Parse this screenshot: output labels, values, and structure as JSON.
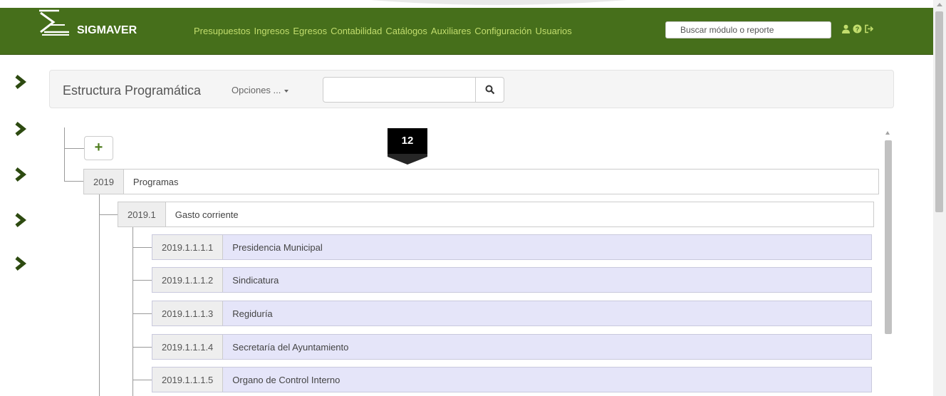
{
  "app": {
    "brand": "SIGMAVER",
    "accent_color": "#466f1b",
    "link_color": "#c2dd6d"
  },
  "nav": {
    "items": [
      "Presupuestos",
      "Ingresos",
      "Egresos",
      "Contabilidad",
      "Catálogos",
      "Auxiliares",
      "Configuración",
      "Usuarios"
    ],
    "search_placeholder": "Buscar módulo o reporte",
    "icons": [
      "user-icon",
      "help-icon",
      "logout-icon"
    ]
  },
  "sidebar": {
    "icons": [
      "chevron-right-icon",
      "chevron-right-icon",
      "chevron-right-icon",
      "chevron-right-icon",
      "chevron-right-icon"
    ]
  },
  "toolbar": {
    "title": "Estructura Programática",
    "options_label": "Opciones ...",
    "search_value": "",
    "search_icon": "search-icon"
  },
  "tree": {
    "add_label": "+",
    "step_badge": "12",
    "root": {
      "code": "2019",
      "name": "Programas"
    },
    "level1": {
      "code": "2019.1",
      "name": "Gasto corriente"
    },
    "leaves": [
      {
        "code": "2019.1.1.1.1",
        "name": "Presidencia Municipal"
      },
      {
        "code": "2019.1.1.1.2",
        "name": "Sindicatura"
      },
      {
        "code": "2019.1.1.1.3",
        "name": "Regiduría"
      },
      {
        "code": "2019.1.1.1.4",
        "name": "Secretaría del Ayuntamiento"
      },
      {
        "code": "2019.1.1.1.5",
        "name": "Organo de Control Interno"
      }
    ]
  }
}
